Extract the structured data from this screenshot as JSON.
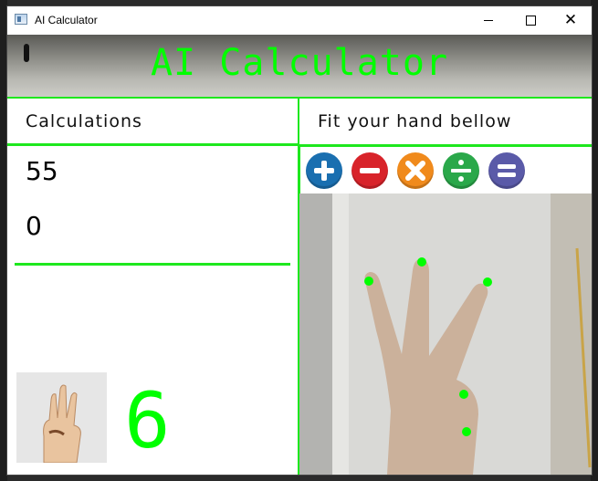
{
  "window": {
    "title": "AI Calculator"
  },
  "app": {
    "title": "AI Calculator"
  },
  "calculations": {
    "label": "Calculations",
    "values": [
      "55",
      "0"
    ]
  },
  "hint": {
    "label": "Fit your hand bellow"
  },
  "operations": [
    {
      "name": "add",
      "symbol": "+",
      "color": "#1a6fb0"
    },
    {
      "name": "subtract",
      "symbol": "−",
      "color": "#d8232a"
    },
    {
      "name": "multiply",
      "symbol": "×",
      "color": "#f08a1c"
    },
    {
      "name": "divide",
      "symbol": "÷",
      "color": "#2aa84a"
    },
    {
      "name": "equals",
      "symbol": "=",
      "color": "#5a5aa8"
    }
  ],
  "gesture": {
    "count": "6"
  },
  "colors": {
    "accent": "#00ff00",
    "divider": "#1ee81e"
  },
  "icons": [
    "window-app-icon",
    "minimize-icon",
    "maximize-icon",
    "close-icon",
    "plus-icon",
    "minus-icon",
    "multiply-icon",
    "divide-icon",
    "equals-icon",
    "hand-gesture-image"
  ]
}
